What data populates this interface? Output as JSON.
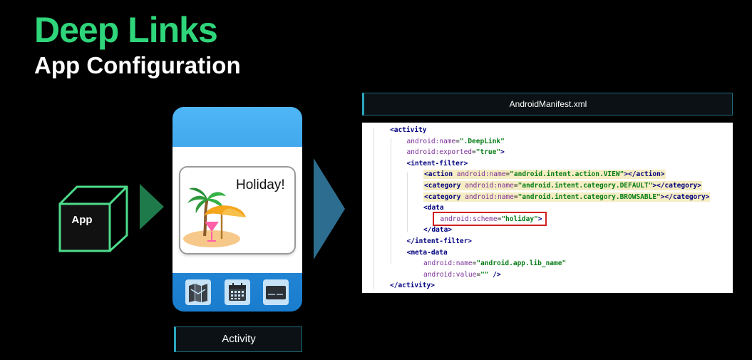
{
  "header": {
    "title": "Deep Links",
    "subtitle": "App Configuration"
  },
  "colors": {
    "title_green": "#2fd57a",
    "arrow_green": "#1e7a4a",
    "arrow_blue": "#2d6d8f",
    "cube_outline": "#4ddc8c",
    "code_highlight": "#f5edc3",
    "scheme_box": "#d22020"
  },
  "app_cube": {
    "label": "App"
  },
  "phone": {
    "card_text": "Holiday!",
    "card_art": "beach-umbrella-palm-cocktail-icon",
    "icons": [
      "map-icon",
      "calendar-icon",
      "credit-card-icon"
    ]
  },
  "activity_label": "Activity",
  "manifest": {
    "filename": "AndroidManifest.xml",
    "lines": [
      {
        "indent": 0,
        "highlight": false,
        "tokens": [
          {
            "t": "<",
            "c": "tag"
          },
          {
            "t": "activity",
            "c": "tag"
          }
        ]
      },
      {
        "indent": 1,
        "highlight": false,
        "tokens": [
          {
            "t": "android:",
            "c": "attr"
          },
          {
            "t": "name",
            "c": "attr"
          },
          {
            "t": "=",
            "c": ""
          },
          {
            "t": "\".DeepLink\"",
            "c": "aval"
          }
        ]
      },
      {
        "indent": 1,
        "highlight": false,
        "tokens": [
          {
            "t": "android:",
            "c": "attr"
          },
          {
            "t": "exported",
            "c": "attr"
          },
          {
            "t": "=",
            "c": ""
          },
          {
            "t": "\"true\"",
            "c": "aval"
          },
          {
            "t": ">",
            "c": "tag"
          }
        ]
      },
      {
        "indent": 1,
        "highlight": false,
        "tokens": [
          {
            "t": "<intent-filter>",
            "c": "tag"
          }
        ]
      },
      {
        "indent": 2,
        "highlight": true,
        "tokens": [
          {
            "t": "<action ",
            "c": "tag"
          },
          {
            "t": "android:",
            "c": "attr"
          },
          {
            "t": "name",
            "c": "attr"
          },
          {
            "t": "=",
            "c": ""
          },
          {
            "t": "\"android.intent.action.VIEW\"",
            "c": "aval"
          },
          {
            "t": "></action>",
            "c": "tag"
          }
        ]
      },
      {
        "indent": 2,
        "highlight": true,
        "tokens": [
          {
            "t": "<category ",
            "c": "tag"
          },
          {
            "t": "android:",
            "c": "attr"
          },
          {
            "t": "name",
            "c": "attr"
          },
          {
            "t": "=",
            "c": ""
          },
          {
            "t": "\"android.intent.category.DEFAULT\"",
            "c": "aval"
          },
          {
            "t": "></category>",
            "c": "tag"
          }
        ]
      },
      {
        "indent": 2,
        "highlight": true,
        "tokens": [
          {
            "t": "<category ",
            "c": "tag"
          },
          {
            "t": "android:",
            "c": "attr"
          },
          {
            "t": "name",
            "c": "attr"
          },
          {
            "t": "=",
            "c": ""
          },
          {
            "t": "\"android.intent.category.BROWSABLE\"",
            "c": "aval"
          },
          {
            "t": "></category>",
            "c": "tag"
          }
        ]
      },
      {
        "indent": 2,
        "highlight": false,
        "tokens": [
          {
            "t": "<data",
            "c": "tag"
          }
        ]
      },
      {
        "indent": 3,
        "highlight": false,
        "tokens": [
          {
            "t": "android:",
            "c": "attr"
          },
          {
            "t": "scheme",
            "c": "attr"
          },
          {
            "t": "=",
            "c": ""
          },
          {
            "t": "\"holiday\"",
            "c": "aval"
          },
          {
            "t": ">",
            "c": "tag"
          }
        ]
      },
      {
        "indent": 2,
        "highlight": false,
        "tokens": [
          {
            "t": "</data>",
            "c": "tag"
          }
        ]
      },
      {
        "indent": 1,
        "highlight": false,
        "tokens": [
          {
            "t": "</intent-filter>",
            "c": "tag"
          }
        ]
      },
      {
        "indent": 1,
        "highlight": false,
        "tokens": [
          {
            "t": "<meta-data",
            "c": "tag"
          }
        ]
      },
      {
        "indent": 2,
        "highlight": false,
        "tokens": [
          {
            "t": "android:",
            "c": "attr"
          },
          {
            "t": "name",
            "c": "attr"
          },
          {
            "t": "=",
            "c": ""
          },
          {
            "t": "\"android.app.lib_name\"",
            "c": "aval"
          }
        ]
      },
      {
        "indent": 2,
        "highlight": false,
        "tokens": [
          {
            "t": "android:",
            "c": "attr"
          },
          {
            "t": "value",
            "c": "attr"
          },
          {
            "t": "=",
            "c": ""
          },
          {
            "t": "\"\"",
            "c": "aval"
          },
          {
            "t": " />",
            "c": "tag"
          }
        ]
      },
      {
        "indent": 0,
        "highlight": false,
        "tokens": [
          {
            "t": "</activity>",
            "c": "tag"
          }
        ]
      }
    ]
  }
}
